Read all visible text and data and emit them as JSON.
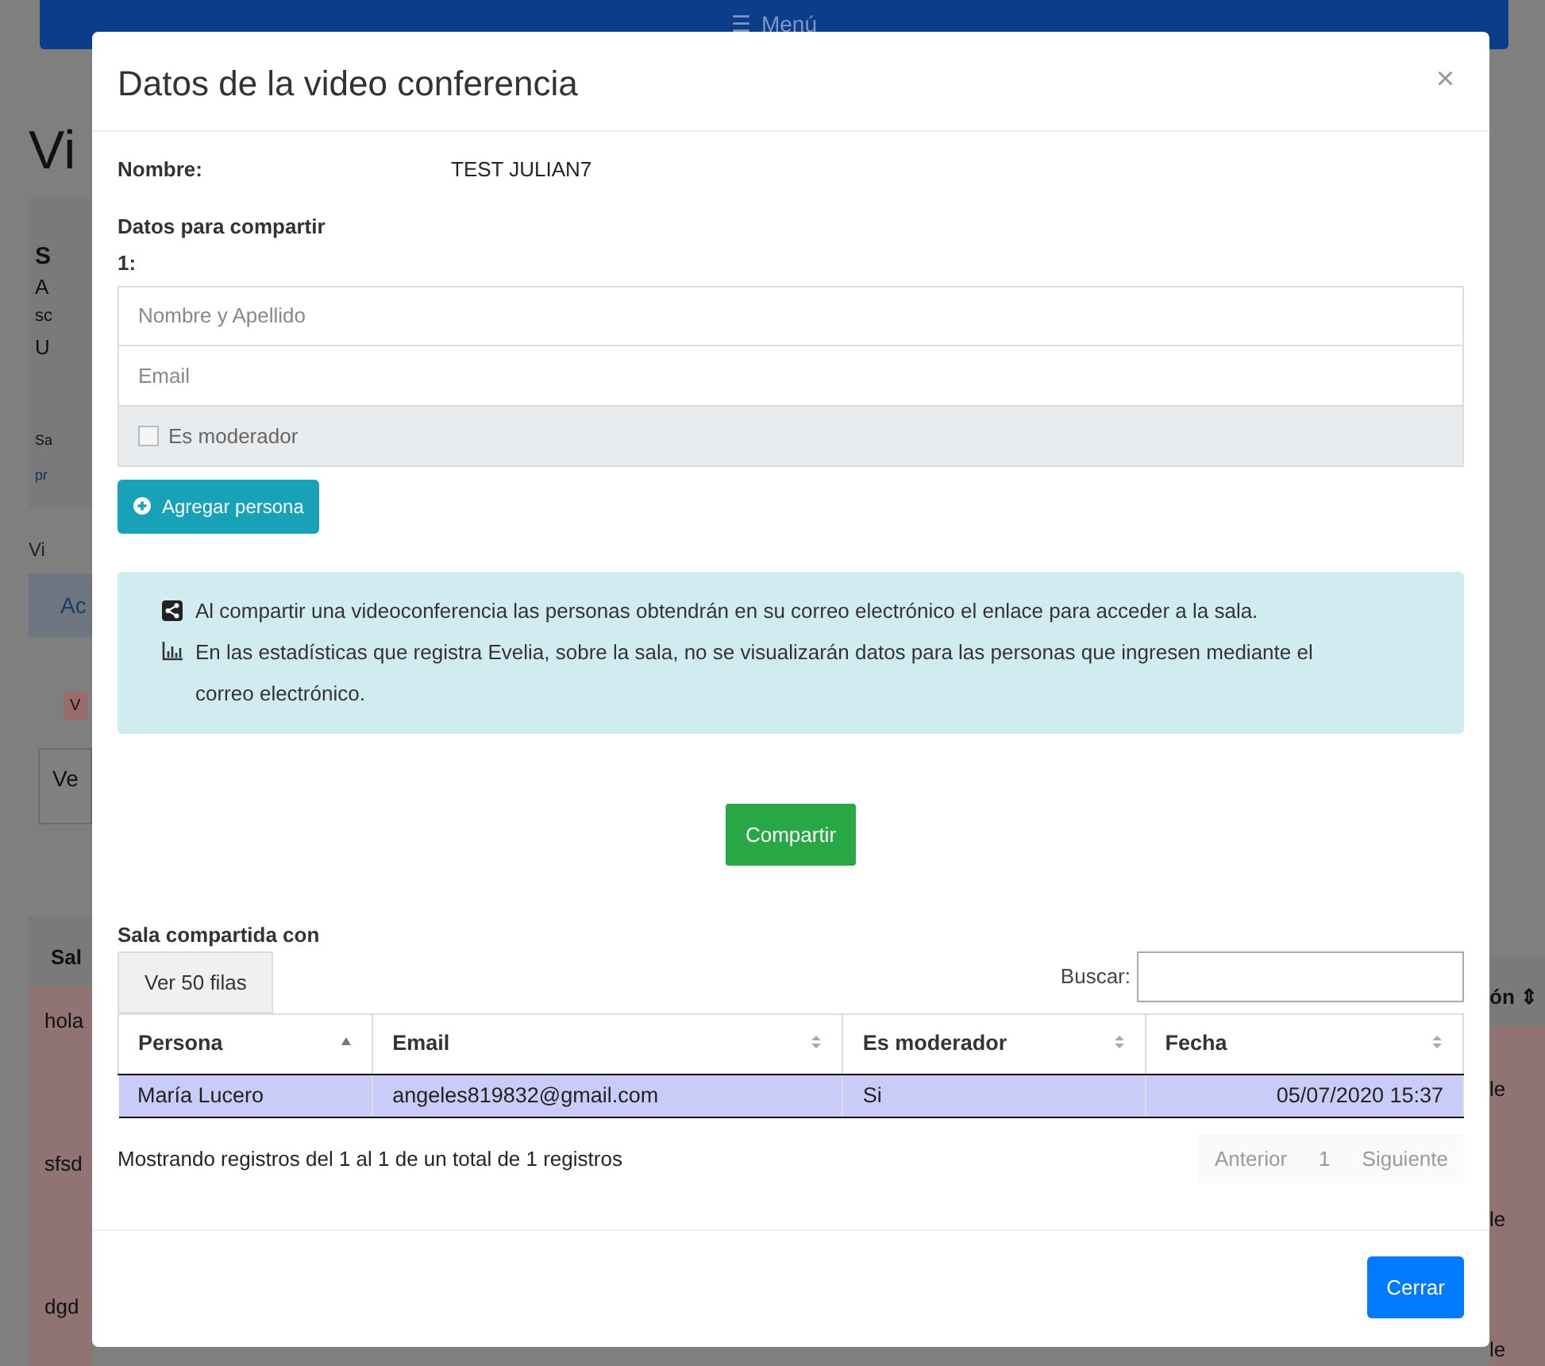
{
  "background": {
    "menu_icon": "☰",
    "menu_label": "Menú",
    "left": [
      {
        "kind": "heading",
        "text": "Vi"
      },
      {
        "kind": "card-title",
        "text": "S"
      },
      {
        "kind": "text",
        "text": "A"
      },
      {
        "kind": "small",
        "text": "sc"
      },
      {
        "kind": "text",
        "text": "U"
      },
      {
        "kind": "tiny",
        "text": "Sa"
      },
      {
        "kind": "link",
        "text": "pr"
      },
      {
        "kind": "image",
        "text": "Vi"
      },
      {
        "kind": "bar",
        "text": "Ac"
      },
      {
        "kind": "tag",
        "text": "V"
      },
      {
        "kind": "field",
        "text": "Ve"
      },
      {
        "kind": "th",
        "text": "Sal"
      },
      {
        "kind": "row",
        "text": "hola"
      },
      {
        "kind": "row",
        "text": "sfsd"
      },
      {
        "kind": "row",
        "text": "dgd"
      }
    ],
    "right": [
      {
        "kind": "th",
        "text": "ón ⇕"
      },
      {
        "kind": "row",
        "text": "le"
      },
      {
        "kind": "row",
        "text": "le"
      },
      {
        "kind": "row",
        "text": "le"
      }
    ]
  },
  "modal": {
    "title": "Datos de la video conferencia",
    "close": "×",
    "name_label": "Nombre:",
    "name_value": "TEST JULIAN7",
    "share_heading": "Datos para compartir",
    "entry_label": "1:",
    "name_field": {
      "placeholder": "Nombre y Apellido"
    },
    "email_field": {
      "placeholder": "Email"
    },
    "moderator": {
      "label": "Es moderador",
      "checked": false
    },
    "add_button": "Agregar persona",
    "notes": [
      "Al compartir una videoconferencia las personas obtendrán en su correo electrónico el enlace para acceder a la sala.",
      "En las estadísticas que registra Evelia, sobre la sala, no se visualizarán datos para las personas que ingresen mediante el correo electrónico."
    ],
    "share_button": "Compartir",
    "shared_heading": "Sala compartida con",
    "rows_button": "Ver 50 filas",
    "search_label": "Buscar:",
    "table": {
      "columns": [
        {
          "label": "Persona",
          "sorted": true
        },
        {
          "label": "Email",
          "sorted": false
        },
        {
          "label": "Es moderador",
          "sorted": false
        },
        {
          "label": "Fecha",
          "sorted": false
        }
      ],
      "rows": [
        {
          "selected": true,
          "cells": [
            "María Lucero",
            "angeles819832@gmail.com",
            "Si",
            "05/07/2020 15:37"
          ]
        }
      ]
    },
    "info": "Mostrando registros del 1 al 1 de un total de 1 registros",
    "pagination": [
      {
        "label": "Anterior",
        "disabled": true
      },
      {
        "label": "1",
        "disabled": true
      },
      {
        "label": "Siguiente",
        "disabled": true
      }
    ],
    "close_button": "Cerrar"
  }
}
